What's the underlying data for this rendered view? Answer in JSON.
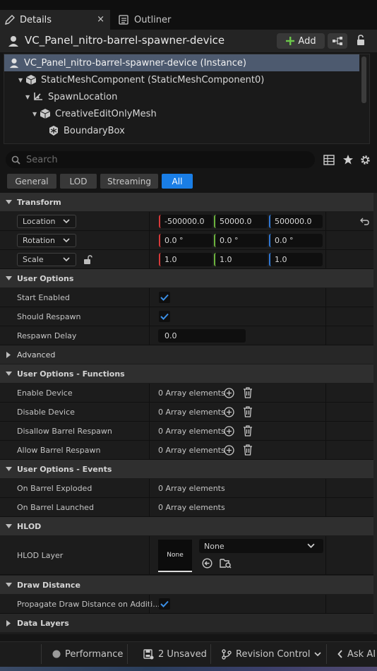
{
  "tabs": {
    "details": "Details",
    "outliner": "Outliner",
    "close": "×"
  },
  "header": {
    "actor_name": "VC_Panel_nitro-barrel-spawner-device",
    "add_label": "Add"
  },
  "tree": {
    "items": [
      {
        "label": "VC_Panel_nitro-barrel-spawner-device (Instance)"
      },
      {
        "label": "StaticMeshComponent (StaticMeshComponent0)"
      },
      {
        "label": "SpawnLocation"
      },
      {
        "label": "CreativeEditOnlyMesh"
      },
      {
        "label": "BoundaryBox"
      }
    ]
  },
  "search": {
    "placeholder": "Search"
  },
  "filters": [
    "General",
    "LOD",
    "Streaming",
    "All"
  ],
  "transform": {
    "title": "Transform",
    "location": {
      "label": "Location",
      "x": "-500000.0",
      "y": "50000.0",
      "z": "500000.0"
    },
    "rotation": {
      "label": "Rotation",
      "x": "0.0 °",
      "y": "0.0 °",
      "z": "0.0 °"
    },
    "scale": {
      "label": "Scale",
      "x": "1.0",
      "y": "1.0",
      "z": "1.0"
    }
  },
  "user_options": {
    "title": "User Options",
    "start_enabled": "Start Enabled",
    "should_respawn": "Should Respawn",
    "respawn_delay": "Respawn Delay",
    "respawn_delay_value": "0.0"
  },
  "advanced": "Advanced",
  "functions": {
    "title": "User Options - Functions",
    "rows": [
      "Enable Device",
      "Disable Device",
      "Disallow Barrel Respawn",
      "Allow Barrel Respawn"
    ],
    "array_text": "0 Array elements"
  },
  "events": {
    "title": "User Options - Events",
    "rows": [
      "On Barrel Exploded",
      "On Barrel Launched"
    ],
    "array_text": "0 Array elements"
  },
  "hlod": {
    "title": "HLOD",
    "layer_label": "HLOD Layer",
    "thumb_text": "None",
    "dropdown_value": "None"
  },
  "draw_distance": {
    "title": "Draw Distance",
    "propagate": "Propagate Draw Distance on Additi..."
  },
  "data_layers": "Data Layers",
  "statusbar": {
    "performance": "Performance",
    "unsaved": "2 Unsaved",
    "revision": "Revision Control",
    "ask_ai": "Ask AI"
  },
  "colors": {
    "accent": "#1a7ee6",
    "selection": "#4d5a6f",
    "x_axis": "#d93a3a",
    "y_axis": "#6cb33e",
    "z_axis": "#2f78d6",
    "check": "#3b8fe6"
  }
}
